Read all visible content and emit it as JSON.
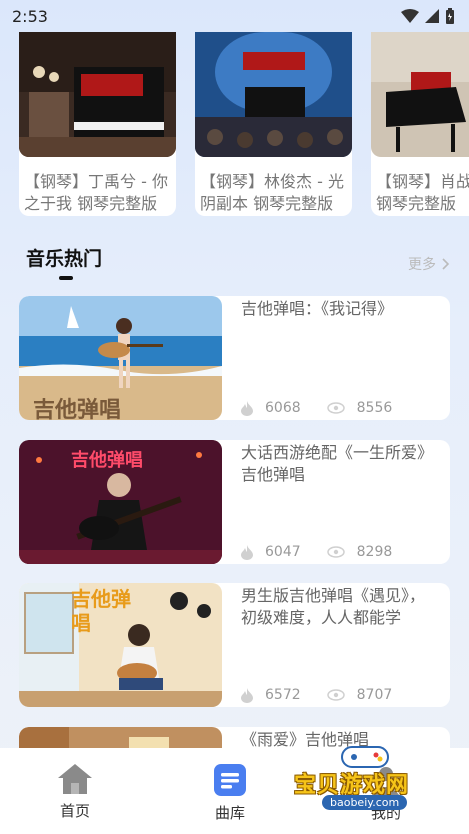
{
  "status_bar": {
    "time": "2:53"
  },
  "top_cards": [
    {
      "title": "【钢琴】丁禹兮 - 你之于我 钢琴完整版"
    },
    {
      "title": "【钢琴】林俊杰 - 光阴副本 钢琴完整版"
    },
    {
      "title": "【钢琴】肖战 - 我们 钢琴完整版"
    }
  ],
  "section": {
    "title": "音乐热门",
    "more_label": "更多"
  },
  "items": [
    {
      "title": "吉他弹唱：《我记得》",
      "plays": "6068",
      "views": "8556",
      "thumb_text": "吉他弹唱"
    },
    {
      "title": "大话西游绝配《一生所爱》吉他弹唱",
      "plays": "6047",
      "views": "8298",
      "thumb_text": "吉他弹唱"
    },
    {
      "title": "男生版吉他弹唱《遇见》，初级难度，人人都能学",
      "plays": "6572",
      "views": "8707",
      "thumb_text": "吉他弹唱"
    },
    {
      "title": "《雨爱》吉他弹唱",
      "plays": "",
      "views": ""
    }
  ],
  "nav": {
    "home": "首页",
    "library": "曲库",
    "mine": "我的"
  },
  "watermark": {
    "text": "宝贝游戏网",
    "url": "baobeiy.com"
  },
  "colors": {
    "accent": "#4a7ef0",
    "background": "#e3ebfa"
  }
}
